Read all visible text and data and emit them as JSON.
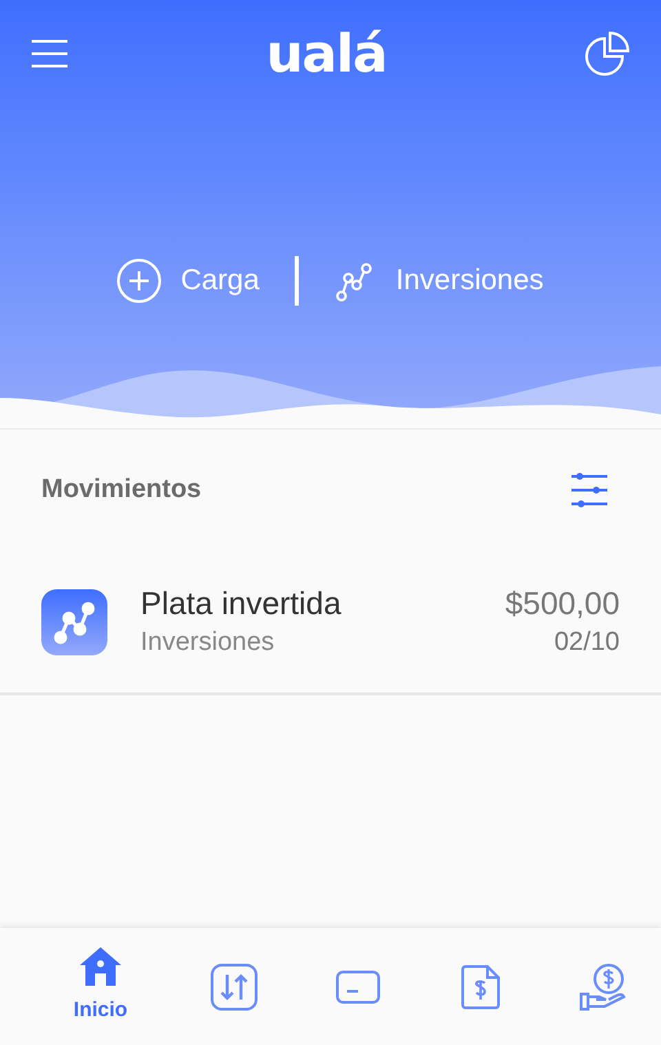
{
  "header": {
    "logo": "ualá"
  },
  "actions": [
    {
      "kind": "plus",
      "label": "Carga"
    },
    {
      "kind": "chart",
      "label": "Inversiones"
    }
  ],
  "movements": {
    "title": "Movimientos",
    "items": [
      {
        "title": "Plata invertida",
        "subtitle": "Inversiones",
        "amount": "$500,00",
        "date": "02/10"
      }
    ]
  },
  "nav": [
    {
      "kind": "home",
      "label": "Inicio",
      "selected": true
    },
    {
      "kind": "transfer",
      "selected": false
    },
    {
      "kind": "card",
      "selected": false
    },
    {
      "kind": "invoice",
      "selected": false
    },
    {
      "kind": "money",
      "selected": false
    }
  ]
}
